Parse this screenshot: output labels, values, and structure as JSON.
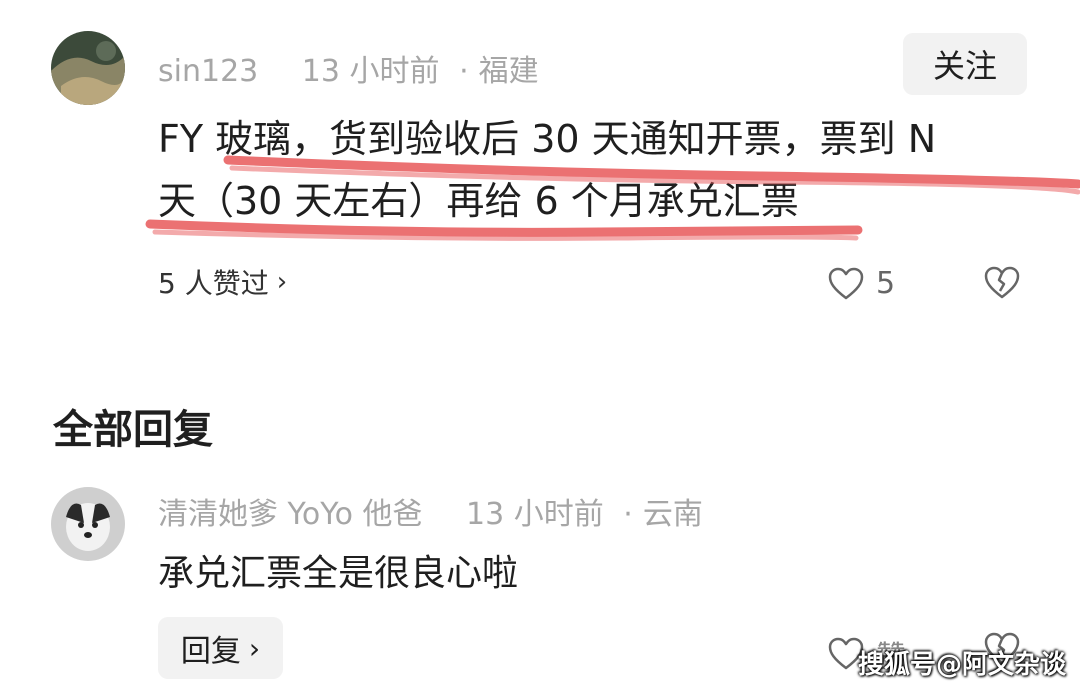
{
  "comment": {
    "username": "sin123",
    "time": "13 小时前",
    "location": "福建",
    "follow_label": "关注",
    "text_line1": "FY 玻璃，货到验收后 30 天通知开票，票到 N",
    "text_line2": "天（30 天左右）再给 6 个月承兑汇票",
    "likes_summary": "5 人赞过",
    "like_count": "5"
  },
  "section_title": "全部回复",
  "reply": {
    "username": "清清她爹 YoYo 他爸",
    "time": "13 小时前",
    "location": "云南",
    "text": "承兑汇票全是很良心啦",
    "reply_label": "回复",
    "like_label": "赞"
  },
  "watermark": "搜狐号@阿文杂谈",
  "colors": {
    "underline": "#e8595a",
    "meta_text": "#a6a6a6",
    "button_bg": "#f2f2f2"
  }
}
